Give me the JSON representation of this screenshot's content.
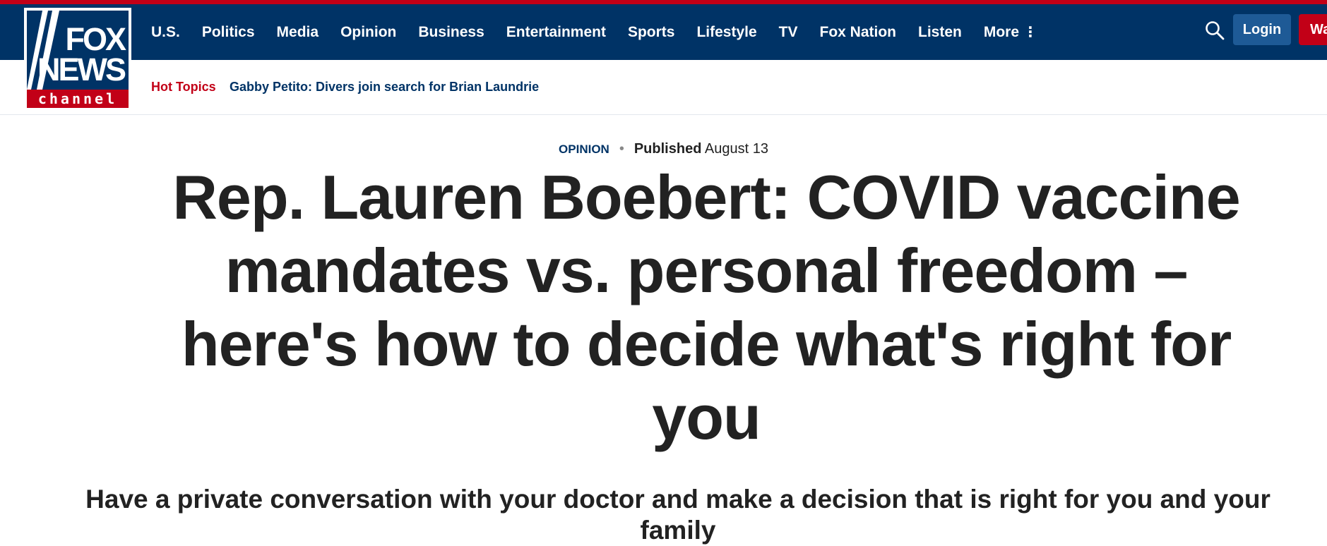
{
  "brand": {
    "logo_line1": "FOX",
    "logo_line2": "NEWS",
    "logo_line3": "channel",
    "primary_color": "#003366",
    "accent_color": "#c20017"
  },
  "nav": {
    "items": [
      "U.S.",
      "Politics",
      "Media",
      "Opinion",
      "Business",
      "Entertainment",
      "Sports",
      "Lifestyle",
      "TV",
      "Fox Nation",
      "Listen"
    ],
    "more_label": "More",
    "more_icon": "vertical-dots-icon",
    "search_icon": "search-icon",
    "login_label": "Login",
    "watch_label": "Wa"
  },
  "subnav": {
    "hot_topics_label": "Hot Topics",
    "hot_topic_link": "Gabby Petito: Divers join search for Brian Laundrie"
  },
  "article": {
    "category": "OPINION",
    "published_label": "Published",
    "published_date": "August 13",
    "headline": "Rep. Lauren Boebert: COVID vaccine mandates vs. personal freedom – here's how to decide what's right for you",
    "subheadline": "Have a private conversation with your doctor and make a decision that is right for you and your family"
  }
}
